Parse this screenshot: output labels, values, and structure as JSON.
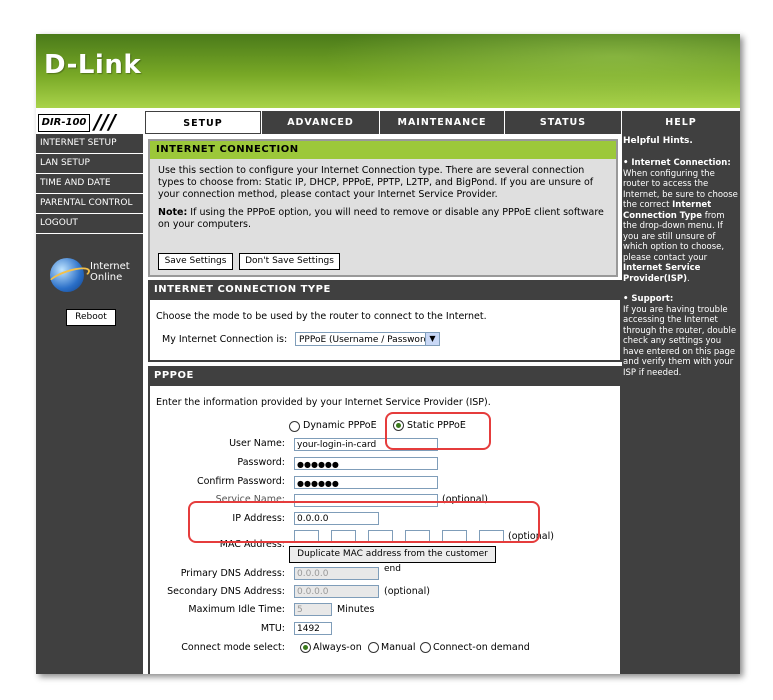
{
  "brand": {
    "logo": "D-Link",
    "model": "DIR-100"
  },
  "tabs": [
    {
      "label": "SETUP",
      "active": true
    },
    {
      "label": "ADVANCED",
      "active": false
    },
    {
      "label": "MAINTENANCE",
      "active": false
    },
    {
      "label": "STATUS",
      "active": false
    },
    {
      "label": "HELP",
      "active": false
    }
  ],
  "sidebar": {
    "items": [
      "INTERNET SETUP",
      "LAN SETUP",
      "TIME AND DATE",
      "PARENTAL CONTROL",
      "LOGOUT"
    ],
    "status_line1": "Internet",
    "status_line2": "Online",
    "reboot_label": "Reboot"
  },
  "intro": {
    "heading": "INTERNET CONNECTION",
    "text": "Use this section to configure your Internet Connection type. There are several connection types to choose from: Static IP, DHCP, PPPoE, PPTP, L2TP, and BigPond. If you are unsure of your connection method, please contact your Internet Service Provider.",
    "note_label": "Note:",
    "note_text": " If using the PPPoE option, you will need to remove or disable any PPPoE client software on your computers.",
    "save_label": "Save Settings",
    "dont_save_label": "Don't Save Settings"
  },
  "conn_type": {
    "heading": "INTERNET CONNECTION TYPE",
    "description": "Choose the mode to be used by the router to connect to the Internet.",
    "label": "My Internet Connection is:",
    "selected": "PPPoE (Username / Password)"
  },
  "pppoe": {
    "heading": "PPPOE",
    "description": "Enter the information provided by your Internet Service Provider (ISP).",
    "dynamic_label": "Dynamic PPPoE",
    "static_label": "Static PPPoE",
    "username_label": "User Name:",
    "username_value": "your-login-in-card",
    "password_label": "Password:",
    "password_value": "●●●●●●",
    "confirm_label": "Confirm Password:",
    "confirm_value": "●●●●●●",
    "service_label": "Service Name:",
    "service_optional": "(optional)",
    "ip_label": "IP Address:",
    "ip_value": "0.0.0.0",
    "mac_label": "MAC Address:",
    "mac_optional": "(optional)",
    "clone_label": "Duplicate MAC address from the customer end",
    "dns1_label": "Primary DNS Address:",
    "dns1_value": "0.0.0.0",
    "dns2_label": "Secondary DNS Address:",
    "dns2_value": "0.0.0.0",
    "dns2_optional": "(optional)",
    "idle_label": "Maximum Idle Time:",
    "idle_value": "5",
    "idle_unit": "Minutes",
    "mtu_label": "MTU:",
    "mtu_value": "1492",
    "mode_label": "Connect mode select:",
    "mode_always": "Always-on",
    "mode_manual": "Manual",
    "mode_demand": "Connect-on demand"
  },
  "hints": {
    "title": "Helpful Hints.",
    "ic_title": "• Internet Connection:",
    "ic_text1": "When configuring the router to access the Internet, be sure to choose the correct ",
    "ic_bold1": "Internet Connection Type",
    "ic_text2": " from the drop-down menu. If you are still unsure of which option to choose, please contact your ",
    "ic_bold2": "Internet Service Provider(ISP)",
    "ic_text3": ".",
    "support_title": "• Support:",
    "support_text": "If you are having trouble accessing the Internet through the router, double check any settings you have entered on this page and verify them with your ISP if needed."
  },
  "colors": {
    "brand_green": "#78a826",
    "chrome_gray": "#404040",
    "highlight_red": "#e53c3c"
  }
}
